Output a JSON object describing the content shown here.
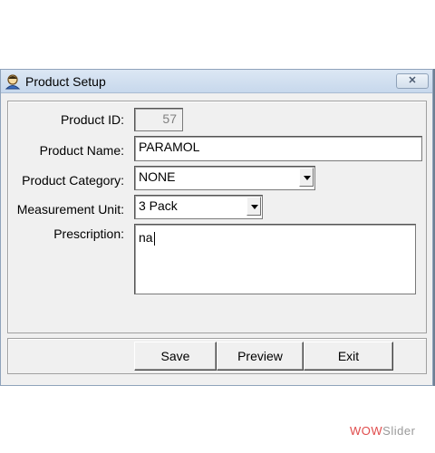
{
  "window": {
    "title": "Product Setup",
    "close_label": "✕"
  },
  "form": {
    "product_id_label": "Product ID:",
    "product_id_value": "57",
    "product_name_label": "Product Name:",
    "product_name_value": "PARAMOL",
    "product_category_label": "Product Category:",
    "product_category_value": "NONE",
    "measurement_unit_label": "Measurement Unit:",
    "measurement_unit_value": "3 Pack",
    "prescription_label": "Prescription:",
    "prescription_value": "na"
  },
  "buttons": {
    "save": "Save",
    "preview": "Preview",
    "exit": "Exit"
  },
  "watermark": {
    "part1": "WOW",
    "part2": "Slider"
  }
}
